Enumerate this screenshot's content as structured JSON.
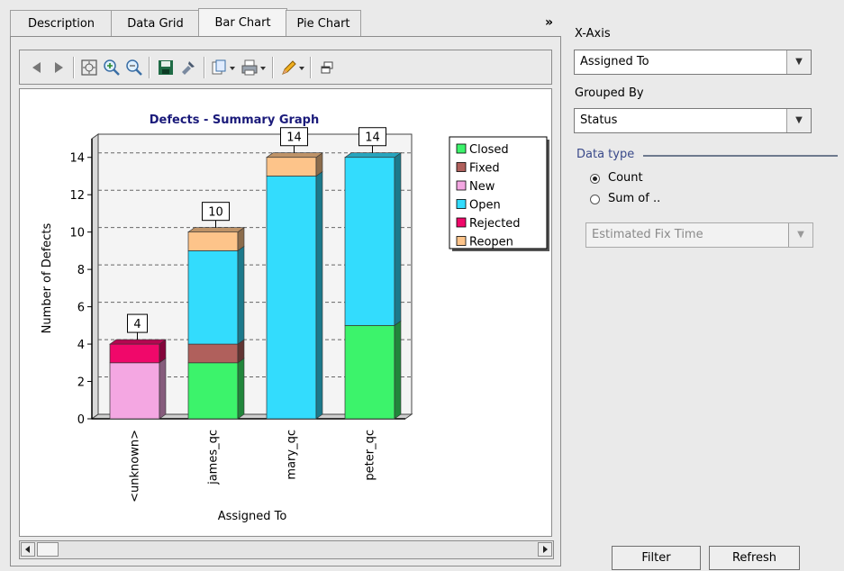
{
  "tabs": [
    {
      "label": "Description"
    },
    {
      "label": "Data Grid"
    },
    {
      "label": "Bar Chart"
    },
    {
      "label": "Pie Chart"
    }
  ],
  "tab_more_label": "»",
  "toolbar_icons": [
    "back-icon",
    "forward-icon",
    "zoom-fit-icon",
    "zoom-in-icon",
    "zoom-out-icon",
    "save-icon",
    "settings-icon",
    "copy-icon",
    "print-icon",
    "edit-icon",
    "popout-icon"
  ],
  "right_panel": {
    "xaxis_label": "X-Axis",
    "xaxis_value": "Assigned To",
    "grouped_label": "Grouped By",
    "grouped_value": "Status",
    "datatype_label": "Data type",
    "radio_count": "Count",
    "radio_sum": "Sum of ..",
    "sum_field_value": "Estimated Fix Time",
    "filter_button": "Filter",
    "refresh_button": "Refresh"
  },
  "chart_data": {
    "type": "bar",
    "stacked": true,
    "title": "Defects - Summary Graph",
    "xlabel": "Assigned To",
    "ylabel": "Number of Defects",
    "ylim": [
      0,
      15
    ],
    "yticks": [
      "0",
      "2",
      "4",
      "6",
      "8",
      "10",
      "12",
      "14"
    ],
    "categories": [
      "<unknown>",
      "james_qc",
      "mary_qc",
      "peter_qc"
    ],
    "totals": [
      "4",
      "10",
      "14",
      "14"
    ],
    "series": [
      {
        "name": "Closed",
        "color": "#3cf36b",
        "values": [
          0,
          3,
          0,
          5
        ]
      },
      {
        "name": "Fixed",
        "color": "#b0605c",
        "values": [
          0,
          1,
          0,
          0
        ]
      },
      {
        "name": "New",
        "color": "#f4a7e2",
        "values": [
          3,
          0,
          0,
          0
        ]
      },
      {
        "name": "Open",
        "color": "#33dcfd",
        "values": [
          0,
          5,
          13,
          9
        ]
      },
      {
        "name": "Rejected",
        "color": "#f0086a",
        "values": [
          1,
          0,
          0,
          0
        ]
      },
      {
        "name": "Reopen",
        "color": "#fdc48a",
        "values": [
          0,
          1,
          1,
          0
        ]
      }
    ],
    "grid": true,
    "legend": "top-right"
  }
}
